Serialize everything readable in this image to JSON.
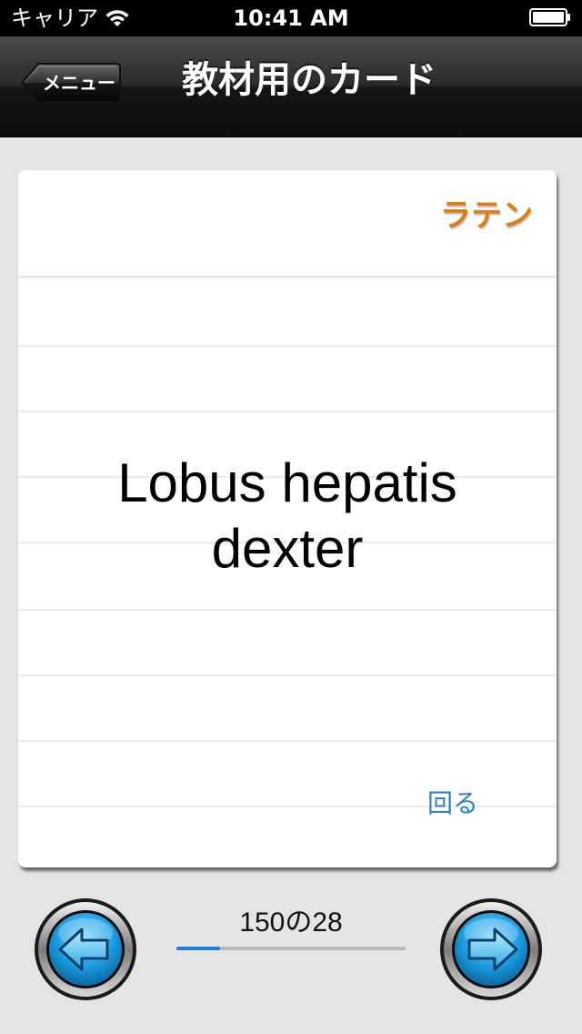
{
  "status_bar": {
    "carrier": "キャリア",
    "time": "10:41 AM",
    "wifi_icon": "wifi-icon",
    "battery_icon": "battery-icon"
  },
  "navbar": {
    "back_label": "メニュー",
    "title": "教材用のカード"
  },
  "card": {
    "language_label": "ラテン",
    "term": "Lobus hepatis dexter",
    "flip_label": "回る"
  },
  "footer": {
    "progress_text": "150の28",
    "progress_fraction": 0.19,
    "prev_icon": "arrow-left-icon",
    "next_icon": "arrow-right-icon"
  },
  "colors": {
    "accent_orange": "#e07d10",
    "link_blue": "#2a7fd2",
    "progress_blue": "#1a7fe0",
    "arrow_blue": "#1aa5e6"
  }
}
